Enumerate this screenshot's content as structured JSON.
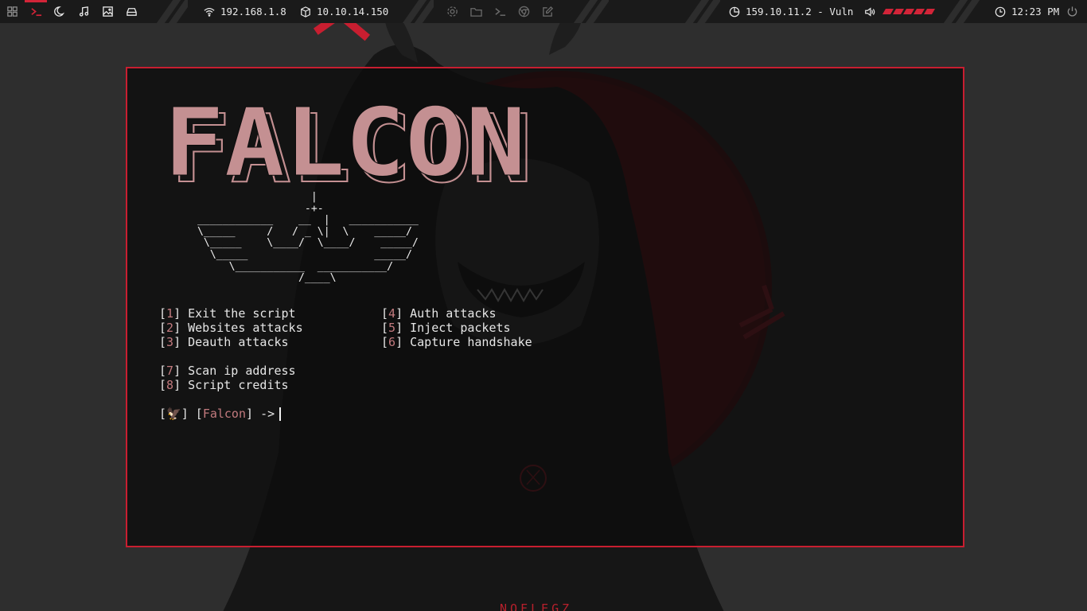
{
  "topbar": {
    "left_icons": [
      "apps-grid-icon",
      "terminal-icon",
      "moon-icon",
      "music-icon",
      "image-icon",
      "drive-icon"
    ],
    "network": {
      "icon": "wifi-icon",
      "ip": "192.168.1.8"
    },
    "vpn": {
      "icon": "cube-icon",
      "ip": "10.10.14.150"
    },
    "center_icons": [
      "settings-icon",
      "folder-icon",
      "terminal-icon",
      "browser-icon",
      "edit-icon"
    ],
    "target": {
      "icon": "chart-pie-icon",
      "label": "159.10.11.2 - Vuln"
    },
    "volume": {
      "icon": "volume-icon",
      "level": 1.0
    },
    "clock": {
      "icon": "clock-icon",
      "time": "12:23 PM"
    },
    "power_icon": "power-icon",
    "accent": "#d22438"
  },
  "terminal": {
    "logo_text": "FALCON",
    "logo_color": "#c49092",
    "ascii_art": "                   |\n                  -+-\n ____________    __  |   ___________\n \\_____     /   / _ \\|  \\    _____/\n  \\_____    \\____/  \\____/    _____/\n   \\_____                    _____/\n      \\___________  ___________/\n                 /____\\",
    "menu_left": [
      {
        "num": "1",
        "label": "Exit the script"
      },
      {
        "num": "2",
        "label": "Websites attacks"
      },
      {
        "num": "3",
        "label": "Deauth attacks"
      },
      {
        "num": "",
        "label": ""
      },
      {
        "num": "7",
        "label": "Scan ip address"
      },
      {
        "num": "8",
        "label": "Script credits"
      }
    ],
    "menu_right": [
      {
        "num": "4",
        "label": "Auth attacks"
      },
      {
        "num": "5",
        "label": "Inject packets"
      },
      {
        "num": "6",
        "label": "Capture handshake"
      }
    ],
    "prompt": {
      "emoji": "🦅",
      "tool": "Falcon",
      "arrow": "->"
    },
    "border_color": "#c81e30"
  },
  "wallpaper": {
    "caption": "NOFLEGZ"
  }
}
